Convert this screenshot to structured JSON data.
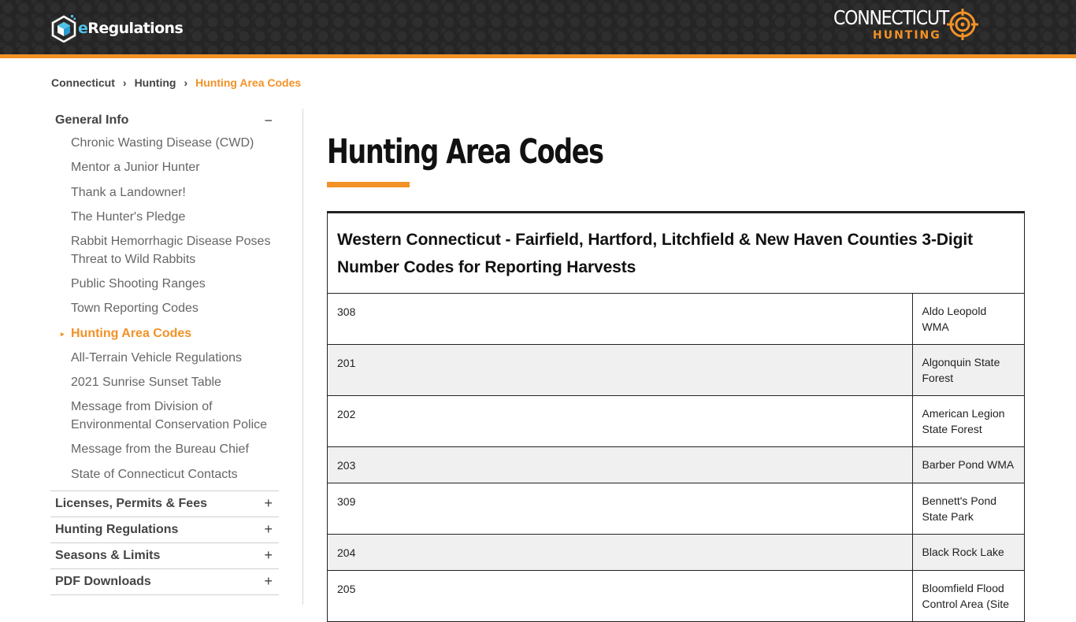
{
  "header": {
    "logo_text_e": "e",
    "logo_text_rest": "Regulations",
    "brand_name": "CONNECTICUT",
    "brand_sub": "HUNTING",
    "accent_color": "#f29226"
  },
  "breadcrumb": {
    "items": [
      "Connecticut",
      "Hunting",
      "Hunting Area Codes"
    ],
    "separator": "›"
  },
  "sidebar": {
    "sections": [
      {
        "title": "General Info",
        "toggle": "−",
        "items": [
          "Chronic Wasting Disease (CWD)",
          "Mentor a Junior Hunter",
          "Thank a Landowner!",
          "The Hunter's Pledge",
          "Rabbit Hemorrhagic Disease Poses Threat to Wild Rabbits",
          "Public Shooting Ranges",
          "Town Reporting Codes",
          "Hunting Area Codes",
          "All-Terrain Vehicle Regulations",
          "2021 Sunrise Sunset Table",
          "Message from Division of Environmental Conservation Police",
          "Message from the Bureau Chief",
          "State of Connecticut Contacts"
        ],
        "active_index": 7,
        "active_marker": "▸"
      },
      {
        "title": "Licenses, Permits & Fees",
        "toggle": "+"
      },
      {
        "title": "Hunting Regulations",
        "toggle": "+"
      },
      {
        "title": "Seasons & Limits",
        "toggle": "+"
      },
      {
        "title": "PDF Downloads",
        "toggle": "+"
      }
    ]
  },
  "main": {
    "title": "Hunting Area Codes",
    "table": {
      "caption": "Western Connecticut - Fairfield, Hartford, Litchfield & New Haven Counties 3-Digit Number Codes for Reporting Harvests",
      "rows": [
        {
          "code": "308",
          "name": "Aldo Leopold WMA"
        },
        {
          "code": "201",
          "name": "Algonquin State Forest"
        },
        {
          "code": "202",
          "name": "American Legion State Forest"
        },
        {
          "code": "203",
          "name": "Barber Pond WMA"
        },
        {
          "code": "309",
          "name": "Bennett's Pond State Park"
        },
        {
          "code": "204",
          "name": "Black Rock Lake"
        },
        {
          "code": "205",
          "name": "Bloomfield Flood Control Area (Site"
        }
      ]
    }
  }
}
